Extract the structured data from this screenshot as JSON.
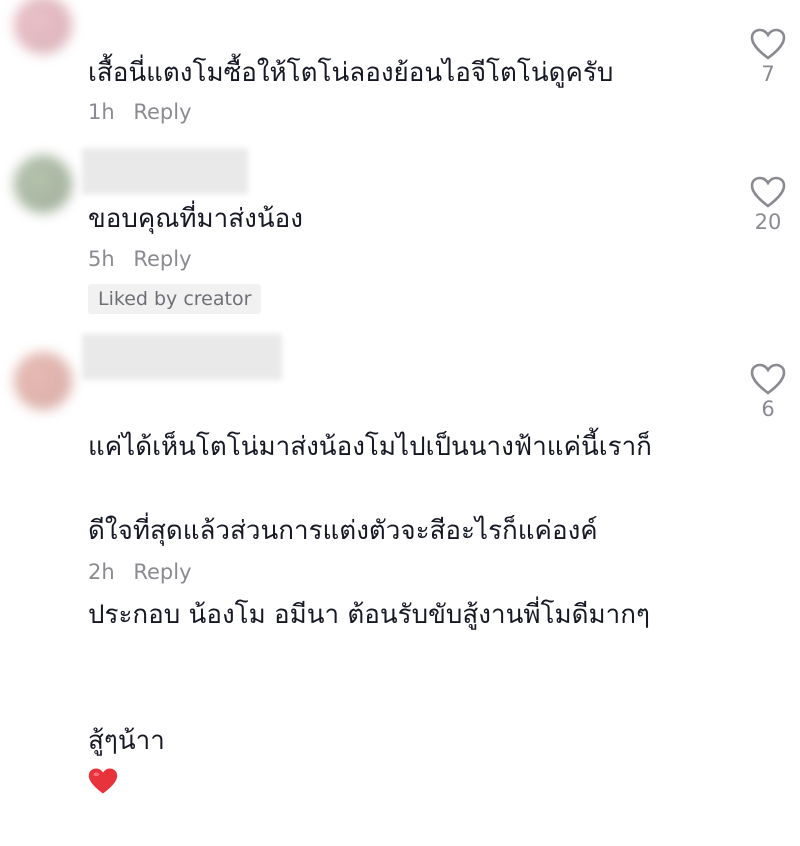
{
  "comments": [
    {
      "text": "เสื้อนี่แตงโมซื้อให้โตโน่ลองย้อนไอจีโตโน่ดูครับ",
      "time": "1h",
      "reply_label": "Reply",
      "likes": "7"
    },
    {
      "text": "ขอบคุณที่มาส่งน้อง",
      "time": "5h",
      "reply_label": "Reply",
      "badge": "Liked by creator",
      "likes": "20"
    },
    {
      "text_lines": [
        "แค่ได้เห็นโตโน่มาส่งน้องโมไปเป็นนางฟ้าแค่นี้เราก็",
        "ดีใจที่สุดแล้วส่วนการแต่งตัวจะสีอะไรก็แค่องค์",
        "ประกอบ น้องโม อมีนา ต้อนรับขับสู้งานพี่โมดีมากๆ",
        "สู้ๆน้าา"
      ],
      "emoji": "red-heart-emoji",
      "time": "2h",
      "reply_label": "Reply",
      "likes": "6"
    }
  ],
  "colors": {
    "text": "#161823",
    "meta": "#8a8b91",
    "heart_emoji": "#e8323c"
  }
}
